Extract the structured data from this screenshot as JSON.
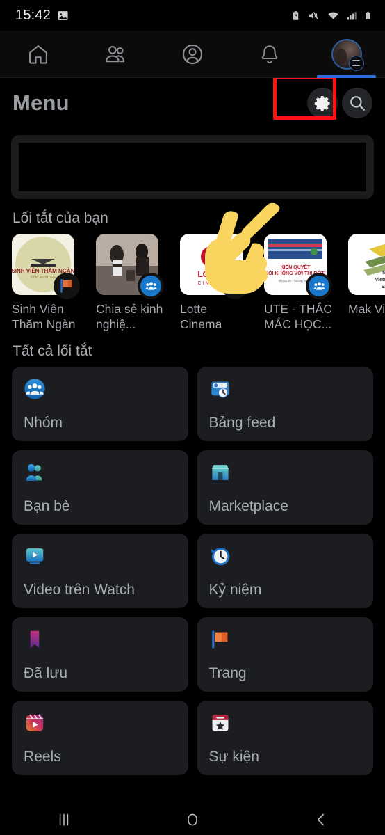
{
  "statusbar": {
    "time": "15:42",
    "left_icons": [
      "image-icon"
    ],
    "right_icons": [
      "battery-saver-icon",
      "volume-mute-icon",
      "wifi-icon",
      "cellular-signal-icon",
      "battery-icon"
    ]
  },
  "topnav": {
    "items": [
      {
        "name": "home",
        "icon": "home-icon",
        "active": false
      },
      {
        "name": "friends",
        "icon": "friends-icon",
        "active": false
      },
      {
        "name": "profile",
        "icon": "profile-circle-icon",
        "active": false
      },
      {
        "name": "notifications",
        "icon": "bell-icon",
        "active": false
      },
      {
        "name": "menu",
        "icon": "avatar-menu-icon",
        "active": true
      }
    ],
    "active_indicator_color": "#2d6fd4"
  },
  "header": {
    "title": "Menu",
    "settings_icon": "gear-icon",
    "search_icon": "search-icon",
    "highlight_color": "#ff1212",
    "highlight_target": "settings-button"
  },
  "pointer": {
    "icon": "pointing-hand-emoji",
    "color": "#f9d35c"
  },
  "banner": {
    "redacted": true,
    "label": ""
  },
  "shortcuts_section": {
    "title": "Lối tắt của bạn",
    "items": [
      {
        "label": "Sinh Viên Thăm Ngàn",
        "thumb_text": "SINH VIÊN THĂM NGÀN",
        "thumb_sub": "STAY POSITIVE",
        "badge": "page-flag-icon",
        "art": "art-svt"
      },
      {
        "label": "Chia sẻ kinh nghiệ...",
        "thumb_text": "",
        "thumb_sub": "",
        "badge": "group-icon",
        "art": "art-chia"
      },
      {
        "label": "Lotte Cinema",
        "thumb_text": "LOTTE",
        "thumb_sub": "C I N E M A",
        "badge": "page-flag-icon",
        "art": "art-lotte"
      },
      {
        "label": "UTE - THẮC MẮC HỌC...",
        "thumb_text": "KIÊN QUYẾT NÓI KHÔNG VỚI THI RỚT!",
        "thumb_sub": "",
        "badge": "group-icon",
        "art": "art-ute"
      },
      {
        "label": "Mak Vietna",
        "thumb_text": "Make Vietnamese Easier",
        "thumb_sub": "",
        "badge": "",
        "art": "art-make"
      }
    ]
  },
  "all_shortcuts_section": {
    "title": "Tất cả lối tắt",
    "items": [
      {
        "label": "Nhóm",
        "icon": "groups-icon"
      },
      {
        "label": "Bảng feed",
        "icon": "news-feed-icon"
      },
      {
        "label": "Bạn bè",
        "icon": "friends-icon"
      },
      {
        "label": "Marketplace",
        "icon": "marketplace-icon"
      },
      {
        "label": "Video trên Watch",
        "icon": "watch-video-icon"
      },
      {
        "label": "Kỷ niệm",
        "icon": "memories-clock-icon"
      },
      {
        "label": "Đã lưu",
        "icon": "bookmark-icon"
      },
      {
        "label": "Trang",
        "icon": "pages-flag-icon"
      },
      {
        "label": "Reels",
        "icon": "reels-icon"
      },
      {
        "label": "Sự kiện",
        "icon": "events-calendar-icon"
      }
    ]
  },
  "sysnav": {
    "items": [
      {
        "name": "recents",
        "icon": "recents-icon"
      },
      {
        "name": "home",
        "icon": "home-square-icon"
      },
      {
        "name": "back",
        "icon": "back-chevron-icon"
      }
    ]
  }
}
